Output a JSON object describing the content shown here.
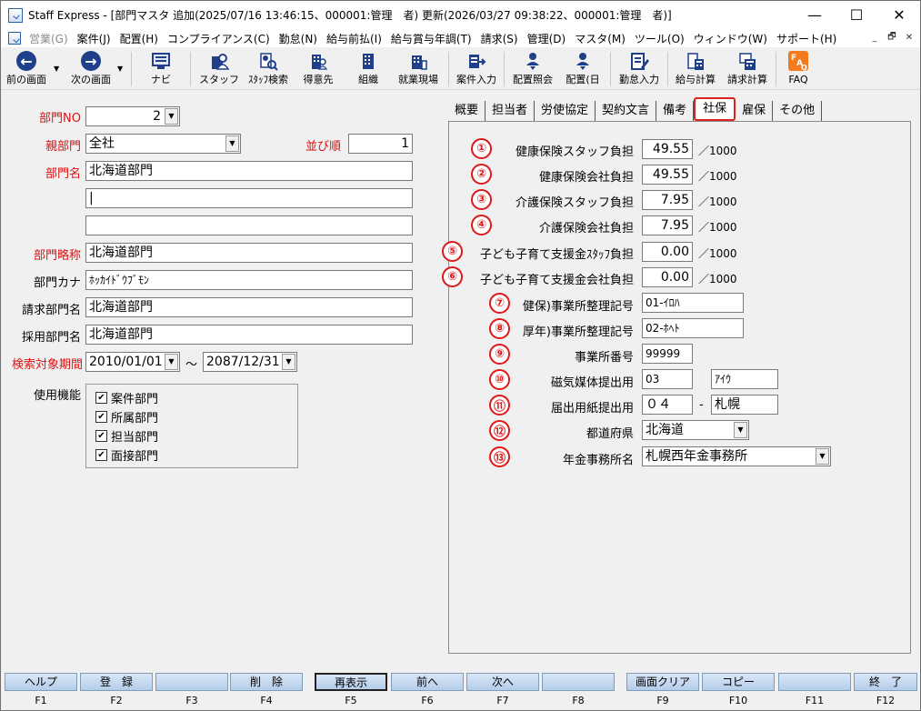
{
  "window": {
    "title": "Staff Express - [部門マスタ 追加(2025/07/16 13:46:15、000001:管理　者) 更新(2026/03/27 09:38:22、000001:管理　者)]",
    "minimize": "—",
    "maximize": "☐",
    "close": "✕"
  },
  "menu": [
    {
      "label": "営業(G)",
      "disabled": true
    },
    {
      "label": "案件(J)"
    },
    {
      "label": "配置(H)"
    },
    {
      "label": "コンプライアンス(C)"
    },
    {
      "label": "勤怠(N)"
    },
    {
      "label": "給与前払(I)"
    },
    {
      "label": "給与賞与年調(T)"
    },
    {
      "label": "請求(S)"
    },
    {
      "label": "管理(D)"
    },
    {
      "label": "マスタ(M)"
    },
    {
      "label": "ツール(O)"
    },
    {
      "label": "ウィンドウ(W)"
    },
    {
      "label": "サポート(H)"
    }
  ],
  "mdi_controls": [
    "_",
    "🗗",
    "✕"
  ],
  "toolbar": {
    "prev": "前の画面",
    "next": "次の画面",
    "navi": "ナビ",
    "staff": "スタッフ",
    "staff_search": "ｽﾀｯﾌ検索",
    "client": "得意先",
    "org": "組織",
    "site": "就業現場",
    "job_entry": "案件入力",
    "assign_inquiry": "配置照会",
    "assign_day": "配置(日",
    "attendance": "勤怠入力",
    "payroll": "給与計算",
    "billing": "請求計算",
    "faq": "FAQ"
  },
  "left_form": {
    "dept_no_label": "部門NO",
    "dept_no_value": "2",
    "parent_label": "親部門",
    "parent_value": "全社",
    "order_label": "並び順",
    "order_value": "1",
    "dept_name_label": "部門名",
    "dept_name_value": "北海道部門",
    "dept_name_line2": "|",
    "dept_name_line3": "",
    "abbr_label": "部門略称",
    "abbr_value": "北海道部門",
    "kana_label": "部門カナ",
    "kana_value": "ﾎｯｶｲﾄﾞｳﾌﾞﾓﾝ",
    "billing_label": "請求部門名",
    "billing_value": "北海道部門",
    "hiring_label": "採用部門名",
    "hiring_value": "北海道部門",
    "period_label": "検索対象期間",
    "period_from": "2010/01/01",
    "period_tilde": "～",
    "period_to": "2087/12/31",
    "functions_label": "使用機能",
    "functions": [
      {
        "label": "案件部門",
        "checked": true
      },
      {
        "label": "所属部門",
        "checked": true
      },
      {
        "label": "担当部門",
        "checked": true
      },
      {
        "label": "面接部門",
        "checked": true
      }
    ]
  },
  "tabs": [
    {
      "label": "概要"
    },
    {
      "label": "担当者"
    },
    {
      "label": "労使協定"
    },
    {
      "label": "契約文言"
    },
    {
      "label": "備考"
    },
    {
      "label": "社保",
      "active": true
    },
    {
      "label": "雇保"
    },
    {
      "label": "その他"
    }
  ],
  "social_insurance": {
    "rows": [
      {
        "no": "①",
        "label": "健康保険スタッフ負担",
        "value": "49.55",
        "unit": "／1000"
      },
      {
        "no": "②",
        "label": "健康保険会社負担",
        "value": "49.55",
        "unit": "／1000"
      },
      {
        "no": "③",
        "label": "介護保険スタッフ負担",
        "value": "7.95",
        "unit": "／1000"
      },
      {
        "no": "④",
        "label": "介護保険会社負担",
        "value": "7.95",
        "unit": "／1000"
      },
      {
        "no": "⑤",
        "label": "子ども子育て支援金ｽﾀｯﾌ負担",
        "value": "0.00",
        "unit": "／1000"
      },
      {
        "no": "⑥",
        "label": "子ども子育て支援金会社負担",
        "value": "0.00",
        "unit": "／1000"
      }
    ],
    "health_office_no": {
      "no": "⑦",
      "label": "健保)事業所整理記号",
      "value": "01-ｲﾛﾊ"
    },
    "pension_office_no": {
      "no": "⑧",
      "label": "厚年)事業所整理記号",
      "value": "02-ﾎﾍﾄ"
    },
    "office_number": {
      "no": "⑨",
      "label": "事業所番号",
      "value": "99999"
    },
    "magnetic": {
      "no": "⑩",
      "label": "磁気媒体提出用",
      "value1": "03",
      "value2": "ｱｲｳ"
    },
    "paper": {
      "no": "⑪",
      "label": "届出用紙提出用",
      "value1": "０４",
      "dash": "-",
      "value2": "札幌"
    },
    "prefecture": {
      "no": "⑫",
      "label": "都道府県",
      "value": "北海道"
    },
    "pension_office": {
      "no": "⑬",
      "label": "年金事務所名",
      "value": "札幌西年金事務所"
    }
  },
  "function_keys": [
    {
      "label": "ヘルプ",
      "key": "F1"
    },
    {
      "label": "登　録",
      "key": "F2"
    },
    {
      "label": "",
      "key": "F3"
    },
    {
      "label": "削　除",
      "key": "F4"
    },
    {
      "label": "再表示",
      "key": "F5",
      "highlight": true
    },
    {
      "label": "前へ",
      "key": "F6"
    },
    {
      "label": "次へ",
      "key": "F7"
    },
    {
      "label": "",
      "key": "F8"
    },
    {
      "label": "画面クリア",
      "key": "F9"
    },
    {
      "label": "コピー",
      "key": "F10"
    },
    {
      "label": "",
      "key": "F11"
    },
    {
      "label": "終　了",
      "key": "F12"
    }
  ]
}
